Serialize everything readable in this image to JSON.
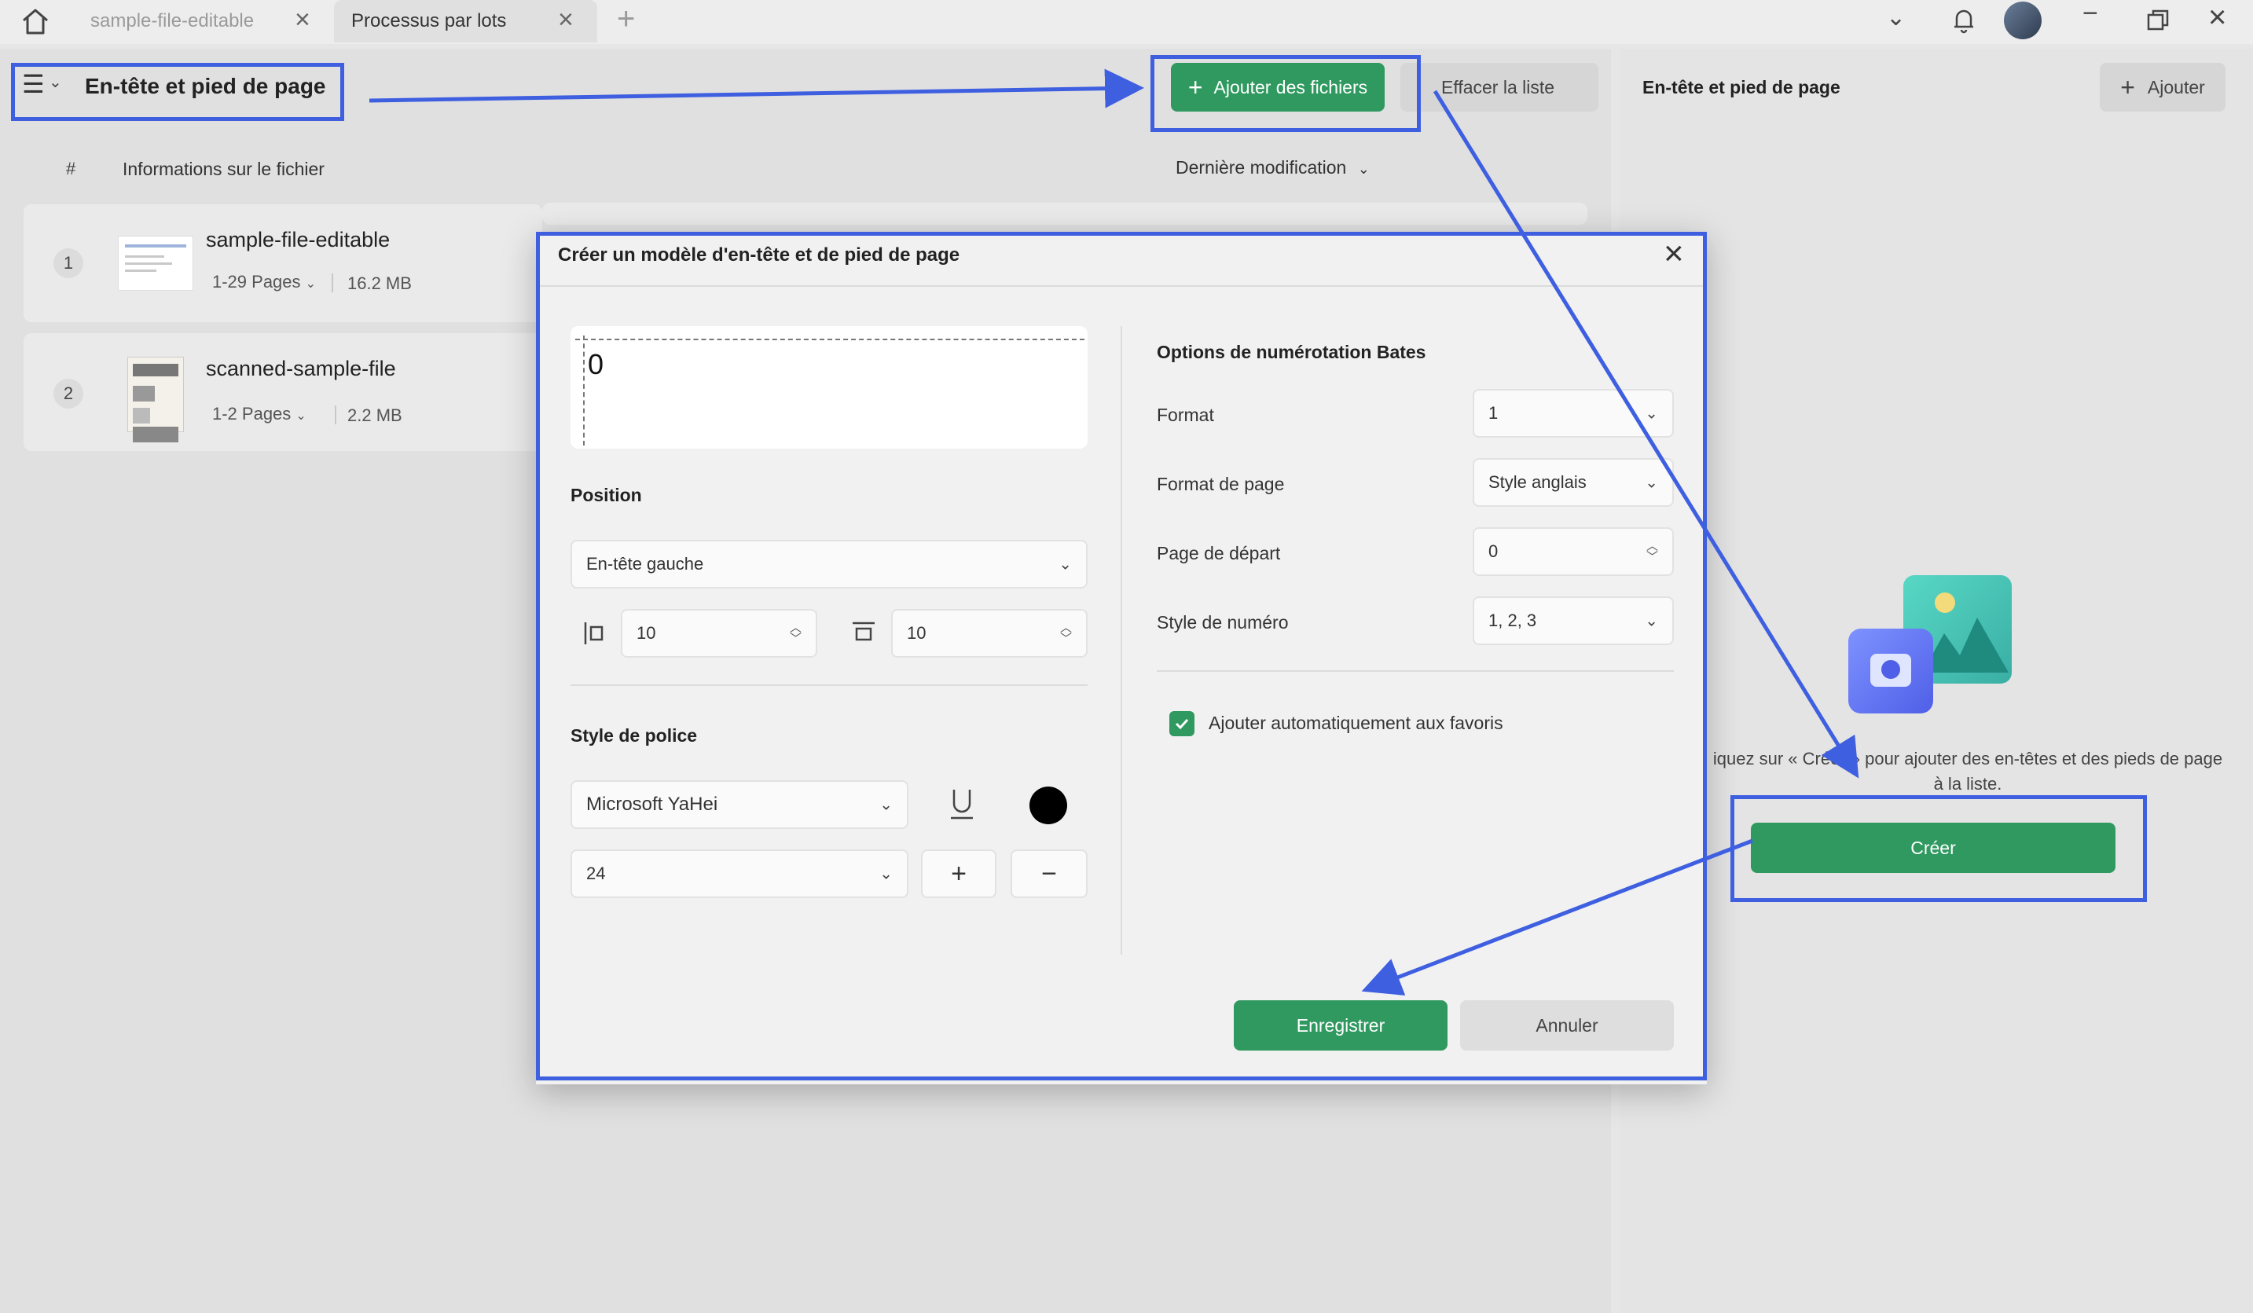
{
  "tabs": [
    {
      "label": "sample-file-editable"
    },
    {
      "label": "Processus par lots"
    }
  ],
  "header": {
    "title": "En-tête et pied de page",
    "add_files_label": "Ajouter des fichiers",
    "clear_list_label": "Effacer la liste"
  },
  "list": {
    "col_number": "#",
    "col_info": "Informations sur le fichier",
    "col_sort": "Dernière modification",
    "files": [
      {
        "index": "1",
        "name": "sample-file-editable",
        "pages": "1-29 Pages",
        "size": "16.2 MB"
      },
      {
        "index": "2",
        "name": "scanned-sample-file",
        "pages": "1-2 Pages",
        "size": "2.2 MB"
      }
    ]
  },
  "right_panel": {
    "title": "En-tête et pied de page",
    "add_label": "Ajouter",
    "hint": "iquez sur « Créer » pour ajouter des en-têtes et des pieds de page à la liste.",
    "create_label": "Créer"
  },
  "dialog": {
    "title": "Créer un modèle d'en-tête et de pied de page",
    "preview_value": "0",
    "position_label": "Position",
    "position_value": "En-tête gauche",
    "margin_left": "10",
    "margin_top": "10",
    "font_style_label": "Style de police",
    "font_value": "Microsoft YaHei",
    "font_size": "24",
    "font_color": "#000000",
    "bates_title": "Options de numérotation Bates",
    "format_label": "Format",
    "format_value": "1",
    "page_format_label": "Format de page",
    "page_format_value": "Style anglais",
    "start_page_label": "Page de départ",
    "start_page_value": "0",
    "number_style_label": "Style de numéro",
    "number_style_value": "1, 2, 3",
    "favorites_label": "Ajouter automatiquement aux favoris",
    "favorites_checked": true,
    "save_label": "Enregistrer",
    "cancel_label": "Annuler"
  },
  "colors": {
    "accent_green": "#2f9960",
    "annotation_blue": "#3e5fe0"
  }
}
